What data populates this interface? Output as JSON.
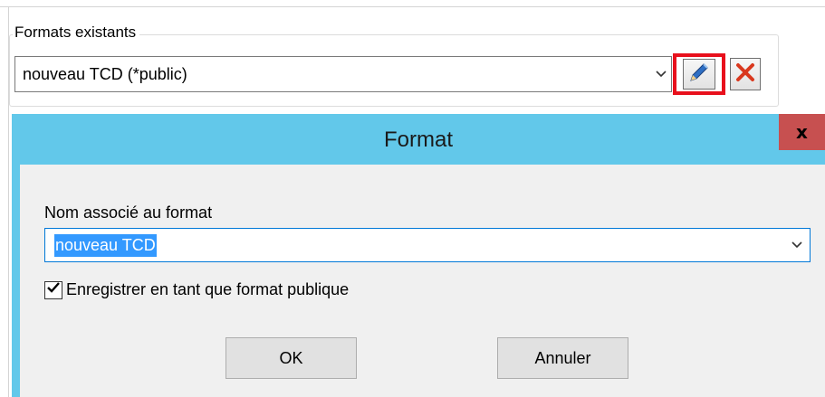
{
  "formats_panel": {
    "group_label": "Formats existants",
    "selected_format": "nouveau TCD (*public)",
    "edit_icon": "pencil-icon",
    "delete_icon": "red-x-icon",
    "highlight_color": "#e8101c"
  },
  "dialog": {
    "title": "Format",
    "close_label": "x",
    "title_bar_color": "#62c8ea",
    "close_color": "#c75050",
    "name_label": "Nom associé au format",
    "name_value": "nouveau TCD",
    "public_checkbox": {
      "label": "Enregistrer en tant que format publique",
      "checked": true
    },
    "ok_label": "OK",
    "cancel_label": "Annuler"
  }
}
